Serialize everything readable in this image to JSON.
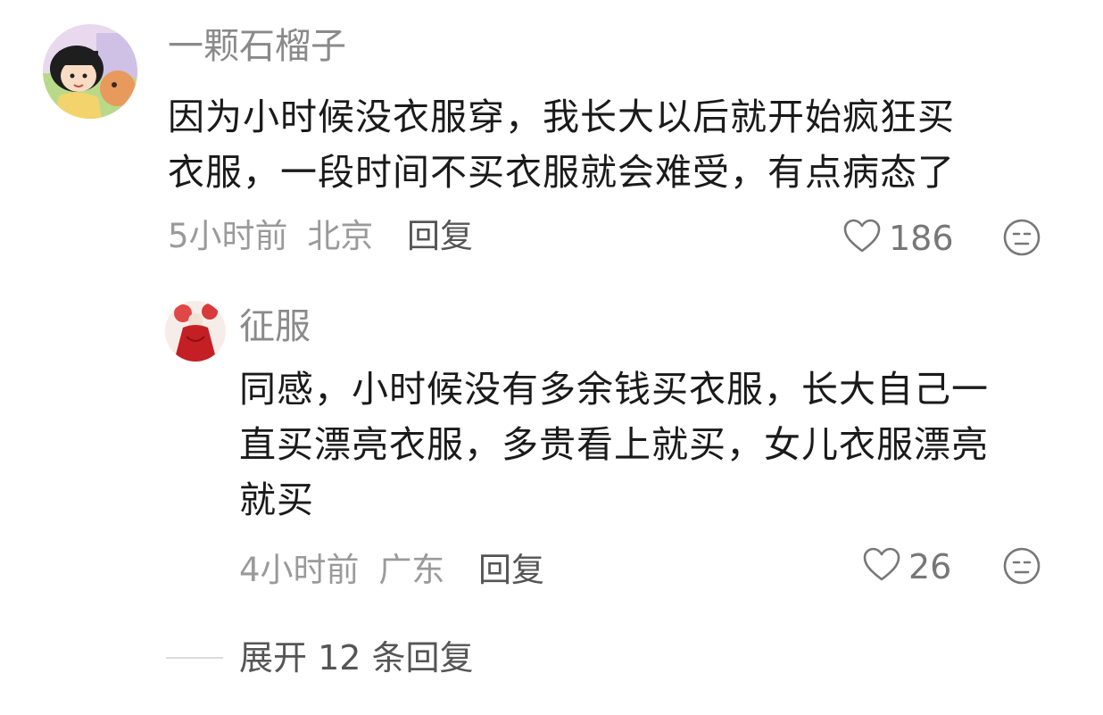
{
  "comment": {
    "username": "一颗石榴子",
    "text_line1": "因为小时候没衣服穿，我长大以后就开始疯狂买",
    "text_line2": "衣服，一段时间不买衣服就会难受，有点病态了",
    "time": "5小时前",
    "location": "北京",
    "reply_label": "回复",
    "like_count": "186",
    "avatar_icon": "cartoon-girl-avatar",
    "like_icon": "heart-outline-icon",
    "dislike_icon": "meh-face-icon"
  },
  "reply": {
    "username": "征服",
    "text_line1": "同感，小时候没有多余钱买衣服，长大自己一",
    "text_line2": "直买漂亮衣服，多贵看上就买，女儿衣服漂亮",
    "text_line3": "就买",
    "time": "4小时前",
    "location": "广东",
    "reply_label": "回复",
    "like_count": "26",
    "avatar_icon": "red-dress-avatar"
  },
  "expand": {
    "label": "展开 12 条回复"
  },
  "colors": {
    "username": "#8a8a8a",
    "text": "#1a1a1a",
    "meta": "#9a9a9a",
    "icon": "#777777"
  }
}
